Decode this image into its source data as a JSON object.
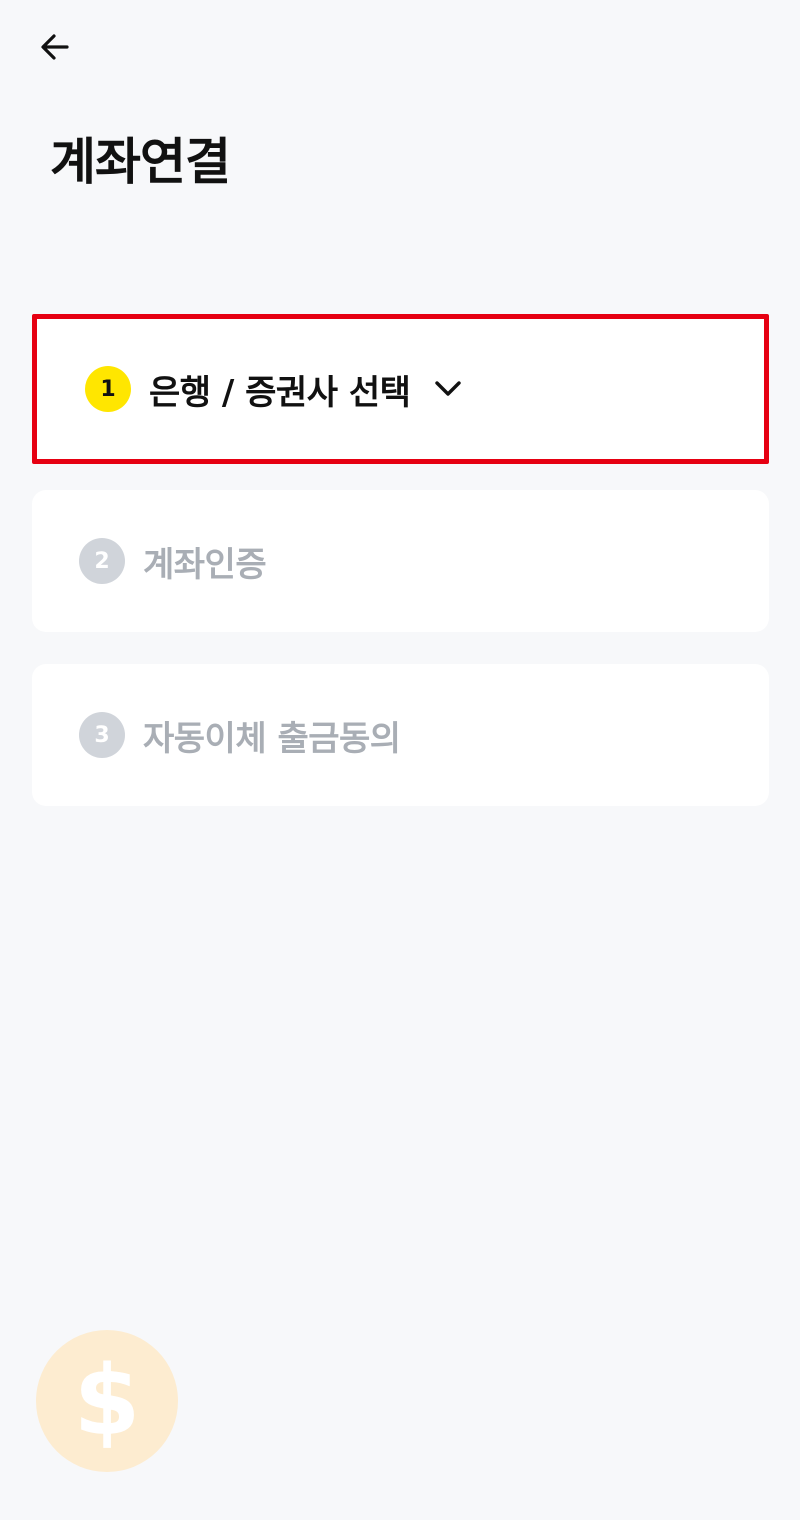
{
  "header": {
    "title": "계좌연결"
  },
  "steps": [
    {
      "number": "1",
      "label": "은행 / 증권사 선택",
      "state": "active"
    },
    {
      "number": "2",
      "label": "계좌인증",
      "state": "inactive"
    },
    {
      "number": "3",
      "label": "자동이체 출금동의",
      "state": "inactive"
    }
  ],
  "fab": {
    "symbol": "$"
  },
  "icons": {
    "back": "arrow-left-icon",
    "dropdown": "chevron-down-icon",
    "fab": "dollar-icon"
  },
  "colors": {
    "background": "#f7f8fa",
    "highlight_border": "#e60012",
    "active_badge": "#ffe600",
    "inactive_badge": "#d0d4da",
    "inactive_text": "#a9aeb5",
    "fab_background": "#fdecd0"
  }
}
